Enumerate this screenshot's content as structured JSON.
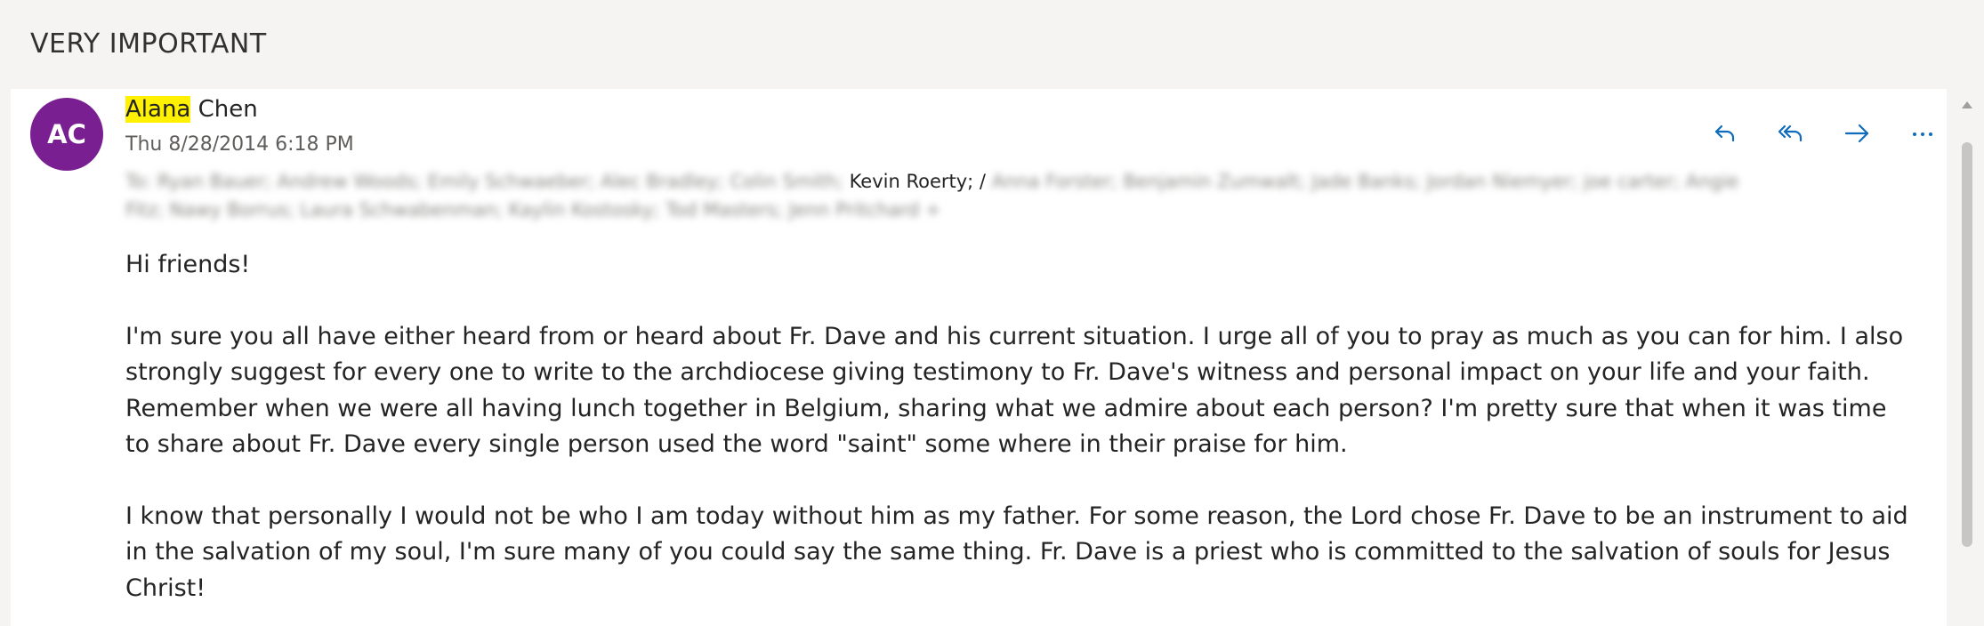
{
  "subject": "VERY IMPORTANT",
  "message": {
    "avatar_initials": "AC",
    "avatar_color": "#7a1f92",
    "sender_highlight": "Alana",
    "sender_rest": " Chen",
    "date": "Thu 8/28/2014 6:18 PM",
    "recipients": {
      "to_prefix": "To:",
      "blurred_before": "Ryan Bauer; Andrew Woods; Emily Schwaeber; Alec Bradley; Colin Smith;",
      "visible_name": "Kevin Roerty; /",
      "blurred_after": "Anna Forster; Benjamin Zumwalt; Jade Banks; Jordan Niemyer; joe carter; Angie Fitz; Nawy Borrus; Laura Schwabenman; Kaylin Kostosky; Tod Masters; Jenn Pritchard +"
    },
    "body": {
      "greeting": "Hi friends!",
      "paragraph_1": "I'm sure you all have either heard from or heard about Fr. Dave and his current situation. I urge all of you to pray as much as you can for him. I also strongly suggest for every one to write to the archdiocese giving testimony to Fr. Dave's witness and personal impact on your life and your faith. Remember when we were all having lunch together in Belgium, sharing what we admire about each person? I'm pretty sure that when it was time to share about Fr. Dave every single person used the word \"saint\" some where in their praise for him.",
      "paragraph_2": "I know that personally I would not be who I am today without him as my father. For some reason, the Lord chose Fr. Dave to be an instrument to aid in the salvation of my soul, I'm sure many of you could say the same thing. Fr. Dave is a priest who is committed to the salvation of souls for Jesus Christ!"
    }
  },
  "actions": {
    "reply_icon": "reply-icon",
    "reply_all_icon": "reply-all-icon",
    "forward_icon": "forward-icon",
    "more_icon": "more-icon",
    "icon_color": "#0f6cbd"
  }
}
